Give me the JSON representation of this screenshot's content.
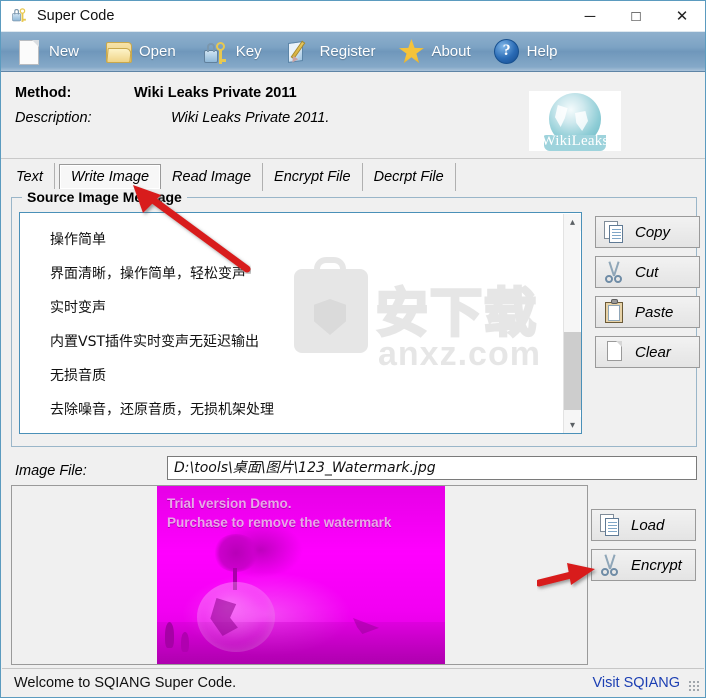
{
  "window": {
    "title": "Super Code",
    "icon": "lock-key-icon",
    "controls": {
      "minimize": "─",
      "maximize": "□",
      "close": "✕"
    }
  },
  "toolbar": {
    "items": [
      {
        "label": "New",
        "icon": "new-page-icon"
      },
      {
        "label": "Open",
        "icon": "folder-open-icon"
      },
      {
        "label": "Key",
        "icon": "lock-key-icon"
      },
      {
        "label": "Register",
        "icon": "register-pencil-icon"
      },
      {
        "label": "About",
        "icon": "star-icon"
      },
      {
        "label": "Help",
        "icon": "question-mark-icon"
      }
    ]
  },
  "info": {
    "method_label": "Method:",
    "method_value": "Wiki Leaks Private 2011",
    "description_label": "Description:",
    "description_value": "Wiki Leaks Private 2011.",
    "logo_text": "WikiLeaks"
  },
  "tabs": [
    {
      "label": "Text",
      "selected": false
    },
    {
      "label": "Write Image",
      "selected": true
    },
    {
      "label": "Read Image",
      "selected": false
    },
    {
      "label": "Encrypt File",
      "selected": false
    },
    {
      "label": "Decrpt File",
      "selected": false
    }
  ],
  "source_group": {
    "title": "Source Image Message",
    "message_lines": [
      "操作简单",
      "界面清晰，操作简单，轻松变声",
      "实时变声",
      "内置VST插件实时变声无延迟输出",
      "无损音质",
      "去除噪音，还原音质，无损机架处理"
    ],
    "watermark": {
      "cn": "安下载",
      "url": "anxz.com"
    },
    "scrollbar": {
      "up": "▴",
      "down": "▾"
    }
  },
  "side_buttons": [
    {
      "label": "Copy",
      "icon": "copy-icon"
    },
    {
      "label": "Cut",
      "icon": "scissors-icon"
    },
    {
      "label": "Paste",
      "icon": "clipboard-icon"
    },
    {
      "label": "Clear",
      "icon": "blank-page-icon"
    }
  ],
  "image_file": {
    "label": "Image File:",
    "value": "D:\\tools\\桌面\\图片\\123_Watermark.jpg",
    "placeholder": ""
  },
  "preview": {
    "watermark_line1": "Trial version Demo.",
    "watermark_line2": "Purchase to remove the watermark"
  },
  "action_buttons": [
    {
      "label": "Load",
      "icon": "copy-icon"
    },
    {
      "label": "Encrypt",
      "icon": "scissors-icon"
    }
  ],
  "status": {
    "text": "Welcome to SQIANG Super Code.",
    "link": "Visit SQIANG"
  },
  "colors": {
    "toolbar_blue": "#7da3c4",
    "accent_border": "#5b9bbf",
    "link": "#1c3fb3",
    "annotation_red": "#d81f1f",
    "preview_magenta": "#ff00ff",
    "wikileaks_teal": "#8fcdd6"
  }
}
